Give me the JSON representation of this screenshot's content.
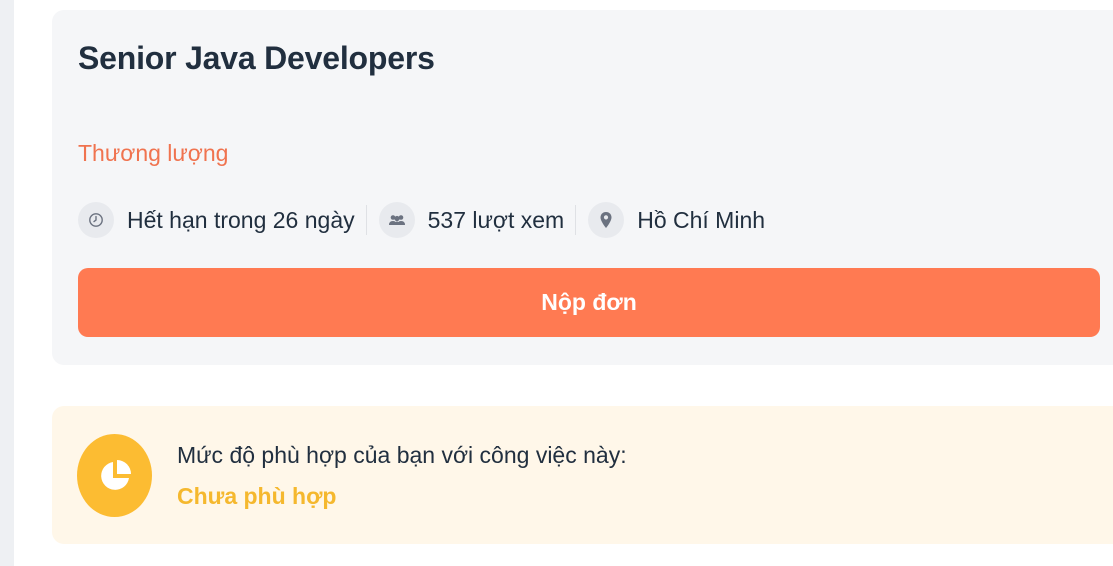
{
  "job": {
    "title": "Senior Java Developers",
    "salary": "Thương lượng",
    "meta": {
      "deadline": {
        "icon": "clock-icon",
        "text": "Hết hạn trong 26 ngày"
      },
      "views": {
        "icon": "people-icon",
        "text": "537 lượt xem"
      },
      "location": {
        "icon": "location-pin-icon",
        "text": "Hồ Chí Minh"
      }
    },
    "apply_label": "Nộp đơn"
  },
  "match": {
    "icon": "pie-chart-icon",
    "question": "Mức độ phù hợp của bạn với công việc này:",
    "status": "Chưa phù hợp"
  },
  "colors": {
    "accent": "#ff7a52",
    "salary": "#f0734f",
    "match_yellow": "#fcbc32",
    "match_bg": "#fff7e9",
    "card_bg": "#f5f6f8"
  }
}
